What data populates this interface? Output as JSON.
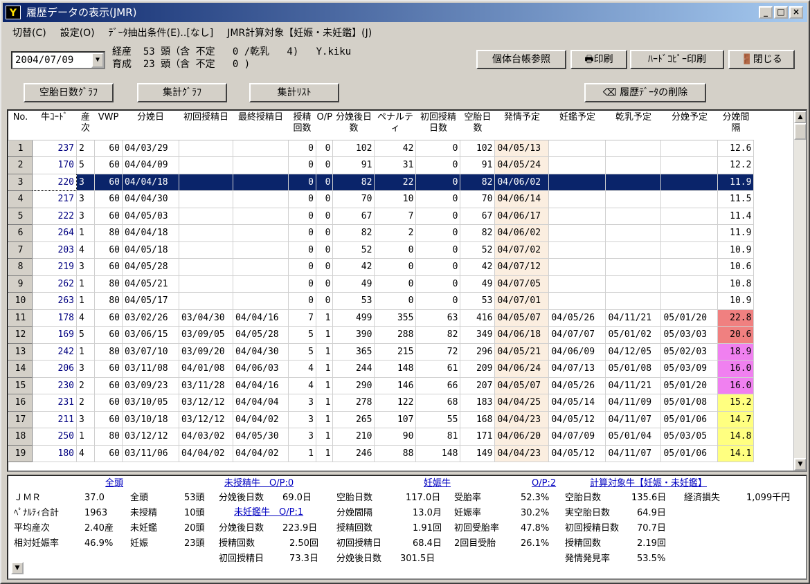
{
  "window": {
    "title": "履歴データの表示(JMR)",
    "min": "_",
    "max": "□",
    "close": "×",
    "icon": "Y"
  },
  "menu": [
    "切替(C)",
    "設定(O)",
    "ﾃﾞｰﾀ抽出条件(E)..[なし]",
    "JMR計算対象【妊娠・未妊鑑】(J)"
  ],
  "date": "2004/07/09",
  "stats_line1": "経産  53 頭（含 不定   0 /乾乳   4)   Y.kiku",
  "stats_line2": "育成  23 頭（含 不定   0 )",
  "buttons": {
    "ledger": "個体台帳参照",
    "print": "印刷",
    "hardcopy": "ﾊｰﾄﾞｺﾋﾟｰ印刷",
    "close": "閉じる",
    "graph_empty": "空胎日数ｸﾞﾗﾌ",
    "graph_total": "集計ｸﾞﾗﾌ",
    "list_total": "集計ﾘｽﾄ",
    "delete": "履歴ﾃﾞｰﾀの削除"
  },
  "columns": [
    "No.",
    "牛ｺｰﾄﾞ",
    "産次",
    "VWP",
    "分娩日",
    "初回授精日",
    "最終授精日",
    "授精回数",
    "O/P",
    "分娩後日数",
    "ペナルティ",
    "初回授精日数",
    "空胎日数",
    "発情予定",
    "妊鑑予定",
    "乾乳予定",
    "分娩予定",
    "分娩間隔"
  ],
  "rows": [
    [
      "1",
      "237",
      "2",
      "60",
      "04/03/29",
      "",
      "",
      "0",
      "0",
      "102",
      "42",
      "0",
      "102",
      "04/05/13",
      "",
      "",
      "",
      "12.6"
    ],
    [
      "2",
      "170",
      "5",
      "60",
      "04/04/09",
      "",
      "",
      "0",
      "0",
      "91",
      "31",
      "0",
      "91",
      "04/05/24",
      "",
      "",
      "",
      "12.2"
    ],
    [
      "3",
      "220",
      "3",
      "60",
      "04/04/18",
      "",
      "",
      "0",
      "0",
      "82",
      "22",
      "0",
      "82",
      "04/06/02",
      "",
      "",
      "",
      "11.9"
    ],
    [
      "4",
      "217",
      "3",
      "60",
      "04/04/30",
      "",
      "",
      "0",
      "0",
      "70",
      "10",
      "0",
      "70",
      "04/06/14",
      "",
      "",
      "",
      "11.5"
    ],
    [
      "5",
      "222",
      "3",
      "60",
      "04/05/03",
      "",
      "",
      "0",
      "0",
      "67",
      "7",
      "0",
      "67",
      "04/06/17",
      "",
      "",
      "",
      "11.4"
    ],
    [
      "6",
      "264",
      "1",
      "80",
      "04/04/18",
      "",
      "",
      "0",
      "0",
      "82",
      "2",
      "0",
      "82",
      "04/06/02",
      "",
      "",
      "",
      "11.9"
    ],
    [
      "7",
      "203",
      "4",
      "60",
      "04/05/18",
      "",
      "",
      "0",
      "0",
      "52",
      "0",
      "0",
      "52",
      "04/07/02",
      "",
      "",
      "",
      "10.9"
    ],
    [
      "8",
      "219",
      "3",
      "60",
      "04/05/28",
      "",
      "",
      "0",
      "0",
      "42",
      "0",
      "0",
      "42",
      "04/07/12",
      "",
      "",
      "",
      "10.6"
    ],
    [
      "9",
      "262",
      "1",
      "80",
      "04/05/21",
      "",
      "",
      "0",
      "0",
      "49",
      "0",
      "0",
      "49",
      "04/07/05",
      "",
      "",
      "",
      "10.8"
    ],
    [
      "10",
      "263",
      "1",
      "80",
      "04/05/17",
      "",
      "",
      "0",
      "0",
      "53",
      "0",
      "0",
      "53",
      "04/07/01",
      "",
      "",
      "",
      "10.9"
    ],
    [
      "11",
      "178",
      "4",
      "60",
      "03/02/26",
      "03/04/30",
      "04/04/16",
      "7",
      "1",
      "499",
      "355",
      "63",
      "416",
      "04/05/07",
      "04/05/26",
      "04/11/21",
      "05/01/20",
      "22.8"
    ],
    [
      "12",
      "169",
      "5",
      "60",
      "03/06/15",
      "03/09/05",
      "04/05/28",
      "5",
      "1",
      "390",
      "288",
      "82",
      "349",
      "04/06/18",
      "04/07/07",
      "05/01/02",
      "05/03/03",
      "20.6"
    ],
    [
      "13",
      "242",
      "1",
      "80",
      "03/07/10",
      "03/09/20",
      "04/04/30",
      "5",
      "1",
      "365",
      "215",
      "72",
      "296",
      "04/05/21",
      "04/06/09",
      "04/12/05",
      "05/02/03",
      "18.9"
    ],
    [
      "14",
      "206",
      "3",
      "60",
      "03/11/08",
      "04/01/08",
      "04/06/03",
      "4",
      "1",
      "244",
      "148",
      "61",
      "209",
      "04/06/24",
      "04/07/13",
      "05/01/08",
      "05/03/09",
      "16.0"
    ],
    [
      "15",
      "230",
      "2",
      "60",
      "03/09/23",
      "03/11/28",
      "04/04/16",
      "4",
      "1",
      "290",
      "146",
      "66",
      "207",
      "04/05/07",
      "04/05/26",
      "04/11/21",
      "05/01/20",
      "16.0"
    ],
    [
      "16",
      "231",
      "2",
      "60",
      "03/10/05",
      "03/12/12",
      "04/04/04",
      "3",
      "1",
      "278",
      "122",
      "68",
      "183",
      "04/04/25",
      "04/05/14",
      "04/11/09",
      "05/01/08",
      "15.2"
    ],
    [
      "17",
      "211",
      "3",
      "60",
      "03/10/18",
      "03/12/12",
      "04/04/02",
      "3",
      "1",
      "265",
      "107",
      "55",
      "168",
      "04/04/23",
      "04/05/12",
      "04/11/07",
      "05/01/06",
      "14.7"
    ],
    [
      "18",
      "250",
      "1",
      "80",
      "03/12/12",
      "04/03/02",
      "04/05/30",
      "3",
      "1",
      "210",
      "90",
      "81",
      "171",
      "04/06/20",
      "04/07/09",
      "05/01/04",
      "05/03/05",
      "14.8"
    ],
    [
      "19",
      "180",
      "4",
      "60",
      "03/11/06",
      "04/04/02",
      "04/04/02",
      "1",
      "1",
      "246",
      "88",
      "148",
      "149",
      "04/04/23",
      "04/05/12",
      "04/11/07",
      "05/01/06",
      "14.1"
    ]
  ],
  "interval_colors": {
    "11": "#f08080",
    "12": "#f08080",
    "13": "#f080f0",
    "14": "#f080f0",
    "15": "#f080f0",
    "16": "#ffff80",
    "17": "#ffff80",
    "18": "#ffff80",
    "19": "#ffff80"
  },
  "summary": {
    "all": {
      "head": "全頭",
      "jmr_l": "ＪＭＲ",
      "jmr": "37.0",
      "all_l": "全頭",
      "all": "53頭",
      "pen_l": "ﾍﾟﾅﾙﾃｨ合計",
      "pen": "1963",
      "unins_l": "未授精",
      "unins": "10頭",
      "par_l": "平均産次",
      "par": "2.40産",
      "unpreg_l": "未妊鑑",
      "unpreg": "20頭",
      "rel_l": "相対妊娠率",
      "rel": "46.9%",
      "preg_l": "妊娠",
      "preg": "23頭"
    },
    "unins": {
      "head": "未授精牛　O/P:0",
      "dpp_l": "分娩後日数",
      "dpp": "69.0日"
    },
    "unpreg": {
      "head": "未妊鑑牛　O/P:1",
      "dpp_l": "分娩後日数",
      "dpp": "223.9日",
      "ins_l": "授精回数",
      "ins": "2.50回",
      "first_l": "初回授精日",
      "first": "73.3日"
    },
    "preg": {
      "head": "妊娠牛",
      "op": "O/P:2",
      "open_l": "空胎日数",
      "open": "117.0日",
      "ci_l": "分娩間隔",
      "ci": "13.0月",
      "ins_l": "授精回数",
      "ins": "1.91回",
      "first_l": "初回授精日",
      "first": "68.4日",
      "dpp_l": "分娩後日数",
      "dpp": "301.5日",
      "cr_l": "受胎率",
      "cr": "52.3%",
      "pr_l": "妊娠率",
      "pr": "30.2%",
      "fcr_l": "初回受胎率",
      "fcr": "47.8%",
      "scr_l": "2回目受胎",
      "scr": "26.1%"
    },
    "calc": {
      "head": "計算対象牛【妊娠・未妊鑑】",
      "open_l": "空胎日数",
      "open": "135.6日",
      "loss_l": "経済損失",
      "loss": "1,099千円",
      "ropen_l": "実空胎日数",
      "ropen": "64.9日",
      "first_l": "初回授精日数",
      "first": "70.7日",
      "ins_l": "授精回数",
      "ins": "2.19回",
      "hd_l": "発情発見率",
      "hd": "53.5%"
    }
  }
}
